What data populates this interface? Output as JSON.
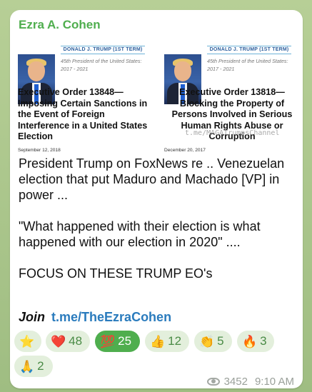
{
  "post": {
    "author": "Ezra A. Cohen",
    "documents": [
      {
        "banner": "DONALD J. TRUMP (1ST TERM)",
        "subtitle": "45th President of the United States: 2017 - 2021",
        "title": "Executive Order 13848—Imposing Certain Sanctions in the Event of Foreign Interference in a United States Election",
        "date": "September 12, 2018"
      },
      {
        "banner": "DONALD J. TRUMP (1ST TERM)",
        "subtitle": "45th President of the United States: 2017 - 2021",
        "title": "Executive Order 13818—Blocking the Property of Persons Involved in Serious Human Rights Abuse or Corruption",
        "date": "December 20, 2017"
      }
    ],
    "watermark": "t.me/MAGATrumpsChannel",
    "paragraphs": [
      "President Trump on FoxNews re .. Venezuelan election that put Maduro and Machado [VP] in power ...",
      "\"What happened with their election is what happened with our election in 2020\" ....",
      "FOCUS ON THESE TRUMP EO's"
    ],
    "join_word": "Join",
    "join_link": "t.me/TheEzraCohen"
  },
  "reactions": [
    {
      "emoji": "⭐",
      "count": ""
    },
    {
      "emoji": "❤️",
      "count": "48"
    },
    {
      "emoji": "💯",
      "count": "25",
      "selected": true
    },
    {
      "emoji": "👍",
      "count": "12"
    },
    {
      "emoji": "👏",
      "count": "5"
    },
    {
      "emoji": "🔥",
      "count": "3"
    },
    {
      "emoji": "🙏",
      "count": "2"
    }
  ],
  "meta": {
    "views": "3452",
    "time": "9:10 AM"
  },
  "colors": {
    "author": "#4fae4e",
    "link": "#2a7bbd",
    "reaction_bg": "#e3efdc",
    "reaction_selected": "#4fae4e"
  }
}
